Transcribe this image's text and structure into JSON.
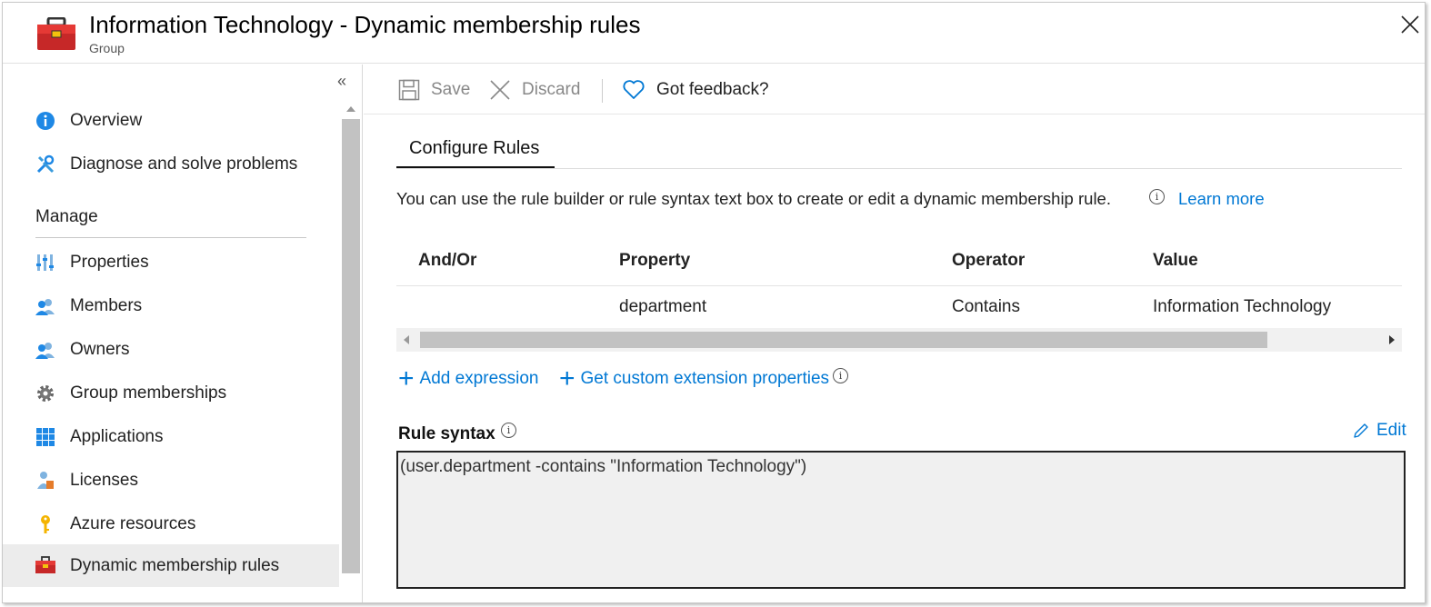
{
  "header": {
    "title": "Information Technology - Dynamic membership rules",
    "subtitle": "Group"
  },
  "sidebar": {
    "collapse_glyph": "«",
    "items_top": [
      {
        "label": "Overview",
        "icon": "info-icon"
      },
      {
        "label": "Diagnose and solve problems",
        "icon": "wrench-icon"
      }
    ],
    "section_title": "Manage",
    "items": [
      {
        "label": "Properties",
        "icon": "properties-icon"
      },
      {
        "label": "Members",
        "icon": "members-icon"
      },
      {
        "label": "Owners",
        "icon": "owners-icon"
      },
      {
        "label": "Group memberships",
        "icon": "gear-icon"
      },
      {
        "label": "Applications",
        "icon": "grid-icon"
      },
      {
        "label": "Licenses",
        "icon": "license-icon"
      },
      {
        "label": "Azure resources",
        "icon": "key-icon"
      },
      {
        "label": "Dynamic membership rules",
        "icon": "toolbox-icon",
        "active": true
      }
    ]
  },
  "toolbar": {
    "save_label": "Save",
    "discard_label": "Discard",
    "feedback_label": "Got feedback?"
  },
  "tabs": [
    {
      "label": "Configure Rules",
      "active": true
    }
  ],
  "description": "You can use the rule builder or rule syntax text box to create or edit a dynamic membership rule.",
  "learn_more": "Learn more",
  "rules_table": {
    "headers": [
      "And/Or",
      "Property",
      "Operator",
      "Value"
    ],
    "rows": [
      [
        "",
        "department",
        "Contains",
        "Information Technology"
      ]
    ]
  },
  "actions": {
    "add_expression": "Add expression",
    "custom_extension": "Get custom extension properties"
  },
  "rule_syntax": {
    "label": "Rule syntax",
    "edit_label": "Edit",
    "value": "(user.department -contains \"Information Technology\")"
  },
  "colors": {
    "link": "#0078d4",
    "active_nav": "#ececec"
  }
}
